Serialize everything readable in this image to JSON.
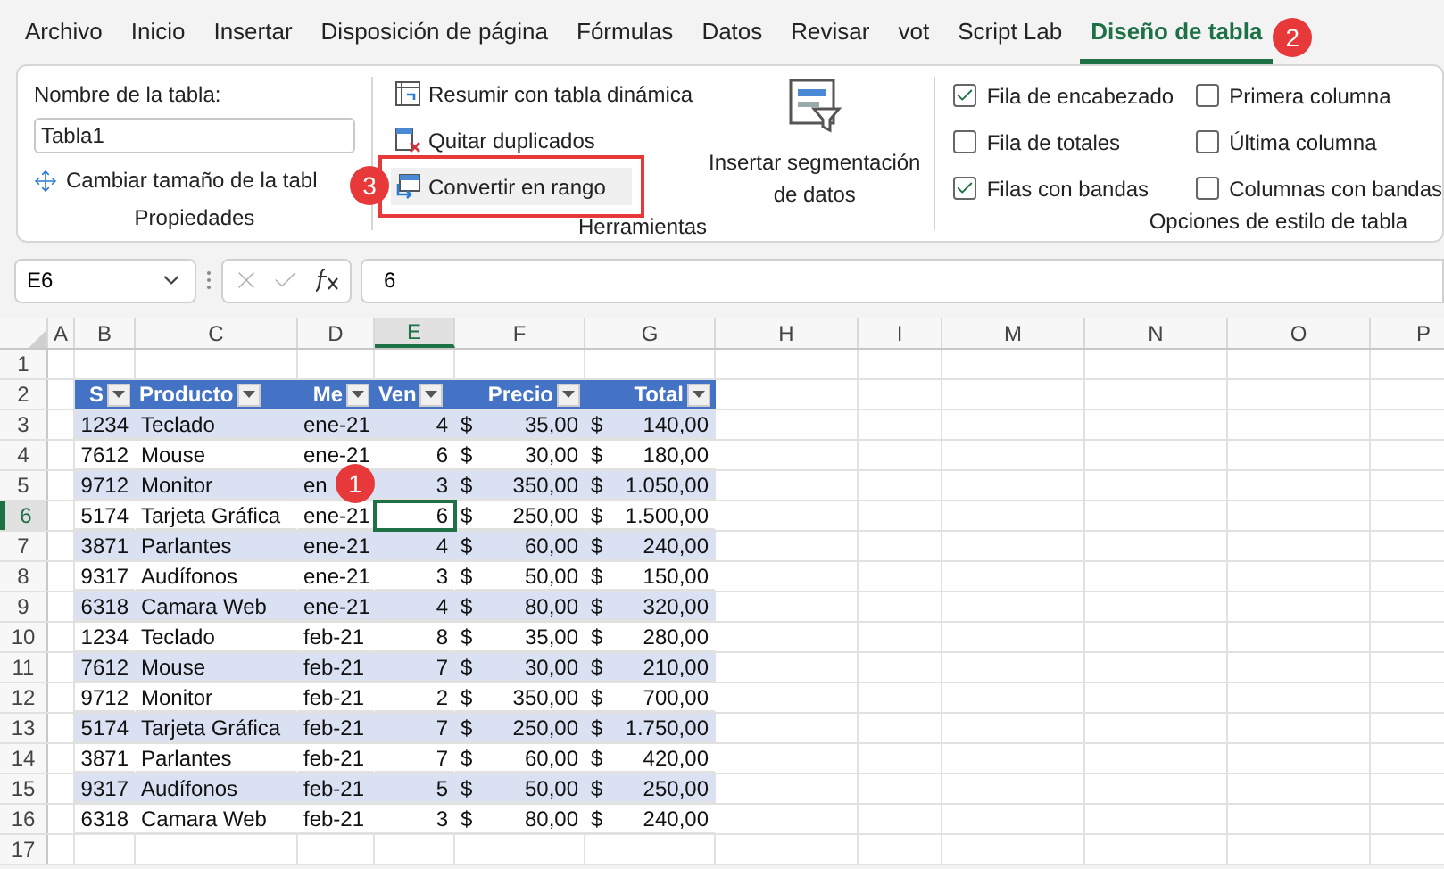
{
  "tabs": [
    {
      "label": "Archivo",
      "selected": false
    },
    {
      "label": "Inicio",
      "selected": false
    },
    {
      "label": "Insertar",
      "selected": false
    },
    {
      "label": "Disposición de página",
      "selected": false
    },
    {
      "label": "Fórmulas",
      "selected": false
    },
    {
      "label": "Datos",
      "selected": false
    },
    {
      "label": "Revisar",
      "selected": false
    },
    {
      "label": "vot",
      "selected": false
    },
    {
      "label": "Script Lab",
      "selected": false
    },
    {
      "label": "Diseño de tabla",
      "selected": true,
      "callout": "2"
    }
  ],
  "ribbon": {
    "properties": {
      "title": "Propiedades",
      "name_label": "Nombre de la tabla:",
      "name_value": "Tabla1",
      "resize_button": "Cambiar tamaño de la tabl",
      "callout": "3"
    },
    "tools": {
      "title": "Herramientas",
      "buttons": [
        {
          "kind": "pivot",
          "label": "Resumir con tabla dinámica",
          "highlighted": false
        },
        {
          "kind": "dedupe",
          "label": "Quitar duplicados",
          "highlighted": false
        },
        {
          "kind": "convert",
          "label": "Convertir en rango",
          "highlighted": true
        }
      ],
      "slicer_button": [
        "Insertar segmentación",
        "de datos"
      ]
    },
    "style_options": {
      "title": "Opciones de estilo de tabla",
      "options": [
        {
          "label": "Fila de encabezado",
          "checked": true
        },
        {
          "label": "Fila de totales",
          "checked": false
        },
        {
          "label": "Filas con bandas",
          "checked": true
        },
        {
          "label": "Primera columna",
          "checked": false
        },
        {
          "label": "Última columna",
          "checked": false
        },
        {
          "label": "Columnas con bandas",
          "checked": false
        }
      ]
    }
  },
  "formula_bar": {
    "name_box": "E6",
    "formula": "6"
  },
  "sheet": {
    "columns": [
      {
        "label": "A",
        "selected": false
      },
      {
        "label": "B",
        "selected": false
      },
      {
        "label": "C",
        "selected": false
      },
      {
        "label": "D",
        "selected": false
      },
      {
        "label": "E",
        "selected": true
      },
      {
        "label": "F",
        "selected": false
      },
      {
        "label": "G",
        "selected": false
      },
      {
        "label": "H",
        "selected": false
      },
      {
        "label": "I",
        "selected": false
      },
      {
        "label": "M",
        "selected": false
      },
      {
        "label": "N",
        "selected": false
      },
      {
        "label": "O",
        "selected": false
      },
      {
        "label": "P",
        "selected": false
      }
    ],
    "row_numbers": [
      {
        "label": "1",
        "selected": false
      },
      {
        "label": "2",
        "selected": false
      },
      {
        "label": "3",
        "selected": false
      },
      {
        "label": "4",
        "selected": false
      },
      {
        "label": "5",
        "selected": false
      },
      {
        "label": "6",
        "selected": true
      },
      {
        "label": "7",
        "selected": false
      },
      {
        "label": "8",
        "selected": false
      },
      {
        "label": "9",
        "selected": false
      },
      {
        "label": "10",
        "selected": false
      },
      {
        "label": "11",
        "selected": false
      },
      {
        "label": "12",
        "selected": false
      },
      {
        "label": "13",
        "selected": false
      },
      {
        "label": "14",
        "selected": false
      },
      {
        "label": "15",
        "selected": false
      },
      {
        "label": "16",
        "selected": false
      },
      {
        "label": "17",
        "selected": false
      }
    ],
    "callout": "1",
    "table": {
      "headers": [
        "S",
        "Producto",
        "Me",
        "Ven",
        "Precio",
        "Total"
      ],
      "rows": [
        {
          "id": "1234",
          "product": "Teclado",
          "month": "ene-21",
          "sales": "4",
          "price": [
            "$",
            "35,00"
          ],
          "total": [
            "$",
            "140,00"
          ],
          "selected": false
        },
        {
          "id": "7612",
          "product": "Mouse",
          "month": "ene-21",
          "sales": "6",
          "price": [
            "$",
            "30,00"
          ],
          "total": [
            "$",
            "180,00"
          ],
          "selected": false
        },
        {
          "id": "9712",
          "product": "Monitor",
          "month": "en",
          "sales": "3",
          "price": [
            "$",
            "350,00"
          ],
          "total": [
            "$",
            "1.050,00"
          ],
          "selected": false
        },
        {
          "id": "5174",
          "product": "Tarjeta Gráfica",
          "month": "ene-21",
          "sales": "6",
          "price": [
            "$",
            "250,00"
          ],
          "total": [
            "$",
            "1.500,00"
          ],
          "selected": true
        },
        {
          "id": "3871",
          "product": "Parlantes",
          "month": "ene-21",
          "sales": "4",
          "price": [
            "$",
            "60,00"
          ],
          "total": [
            "$",
            "240,00"
          ],
          "selected": false
        },
        {
          "id": "9317",
          "product": "Audífonos",
          "month": "ene-21",
          "sales": "3",
          "price": [
            "$",
            "50,00"
          ],
          "total": [
            "$",
            "150,00"
          ],
          "selected": false
        },
        {
          "id": "6318",
          "product": "Camara Web",
          "month": "ene-21",
          "sales": "4",
          "price": [
            "$",
            "80,00"
          ],
          "total": [
            "$",
            "320,00"
          ],
          "selected": false
        },
        {
          "id": "1234",
          "product": "Teclado",
          "month": "feb-21",
          "sales": "8",
          "price": [
            "$",
            "35,00"
          ],
          "total": [
            "$",
            "280,00"
          ],
          "selected": false
        },
        {
          "id": "7612",
          "product": "Mouse",
          "month": "feb-21",
          "sales": "7",
          "price": [
            "$",
            "30,00"
          ],
          "total": [
            "$",
            "210,00"
          ],
          "selected": false
        },
        {
          "id": "9712",
          "product": "Monitor",
          "month": "feb-21",
          "sales": "2",
          "price": [
            "$",
            "350,00"
          ],
          "total": [
            "$",
            "700,00"
          ],
          "selected": false
        },
        {
          "id": "5174",
          "product": "Tarjeta Gráfica",
          "month": "feb-21",
          "sales": "7",
          "price": [
            "$",
            "250,00"
          ],
          "total": [
            "$",
            "1.750,00"
          ],
          "selected": false
        },
        {
          "id": "3871",
          "product": "Parlantes",
          "month": "feb-21",
          "sales": "7",
          "price": [
            "$",
            "60,00"
          ],
          "total": [
            "$",
            "420,00"
          ],
          "selected": false
        },
        {
          "id": "9317",
          "product": "Audífonos",
          "month": "feb-21",
          "sales": "5",
          "price": [
            "$",
            "50,00"
          ],
          "total": [
            "$",
            "250,00"
          ],
          "selected": false
        },
        {
          "id": "6318",
          "product": "Camara Web",
          "month": "feb-21",
          "sales": "3",
          "price": [
            "$",
            "80,00"
          ],
          "total": [
            "$",
            "240,00"
          ],
          "selected": false
        }
      ]
    }
  }
}
